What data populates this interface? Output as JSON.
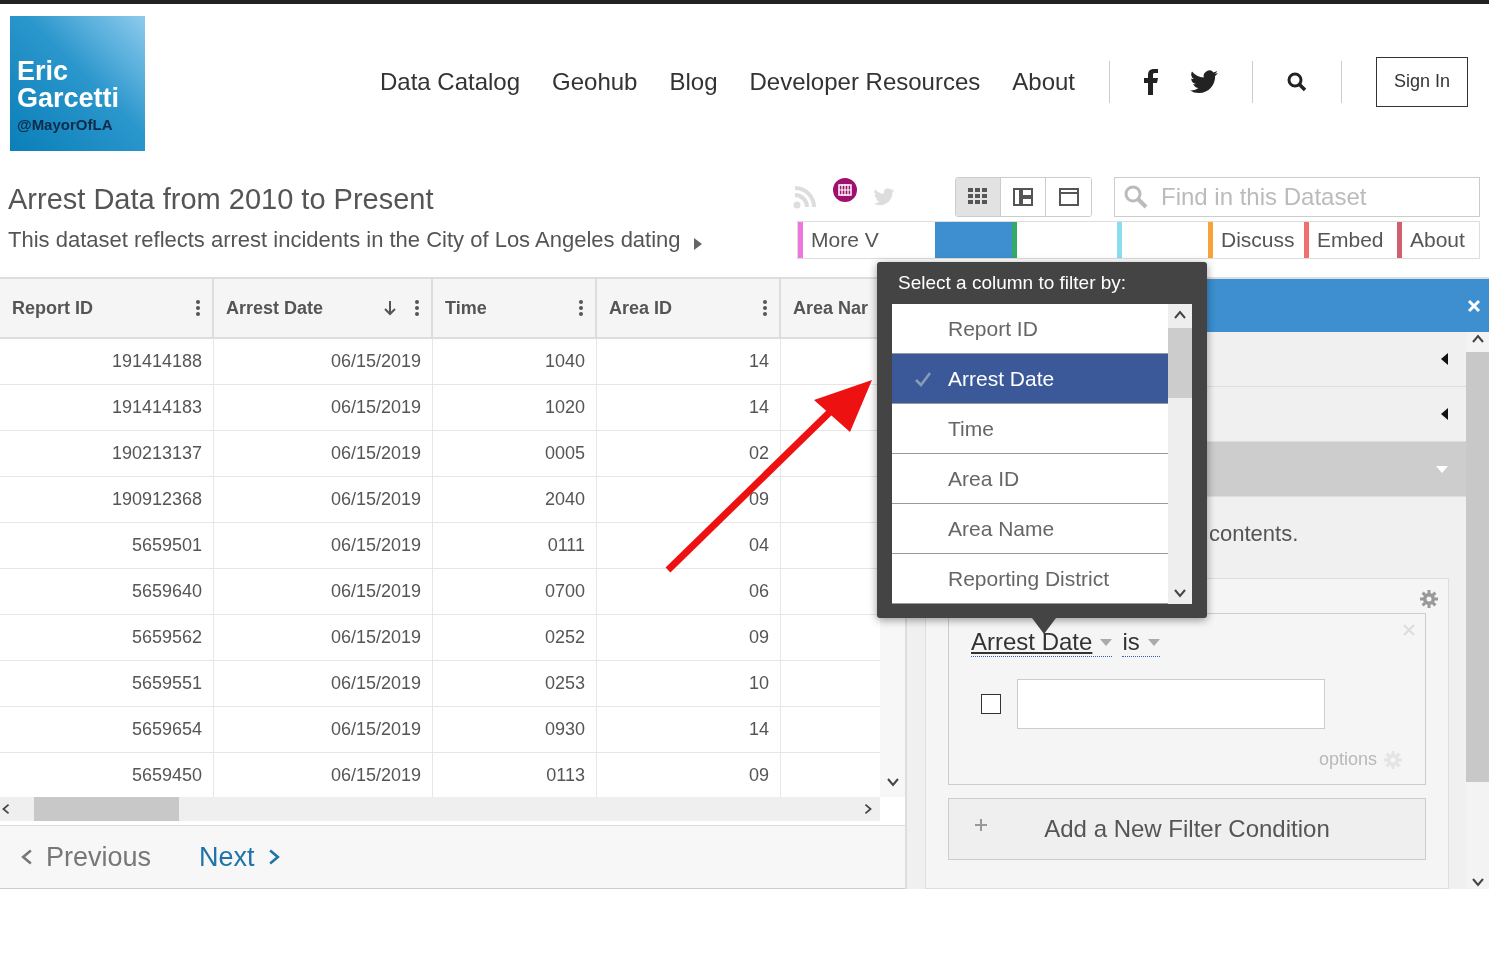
{
  "logo": {
    "line1": "Eric",
    "line2": "Garcetti",
    "handle": "@MayorOfLA"
  },
  "nav": {
    "links": [
      "Data Catalog",
      "Geohub",
      "Blog",
      "Developer Resources",
      "About"
    ],
    "sign_in": "Sign In"
  },
  "dataset": {
    "title": "Arrest Data from 2010 to Present",
    "description": "This dataset reflects arrest incidents in the City of Los Angeles dating"
  },
  "view_modes": [
    {
      "selected": true
    },
    {
      "selected": false
    },
    {
      "selected": false
    }
  ],
  "search": {
    "placeholder": "Find in this Dataset"
  },
  "tabs": [
    {
      "label": "More V",
      "selected": false,
      "color": "#ee77dd"
    },
    {
      "selected": true,
      "color": "#3d8fcf"
    },
    {
      "selected": false,
      "color": "#33aa66"
    },
    {
      "selected": false,
      "color": "#88ddee"
    },
    {
      "label": "Discuss",
      "selected": false,
      "color": "#f5a33a"
    },
    {
      "label": "Embed",
      "selected": false,
      "color": "#f07070"
    },
    {
      "label": "About",
      "selected": false,
      "color": "#d06070"
    }
  ],
  "table": {
    "columns": [
      {
        "label": "Report ID",
        "sorted": false
      },
      {
        "label": "Arrest Date",
        "sorted": true
      },
      {
        "label": "Time",
        "sorted": false
      },
      {
        "label": "Area ID",
        "sorted": false
      },
      {
        "label": "Area Nar",
        "sorted": false
      }
    ],
    "rows": [
      [
        "191414188",
        "06/15/2019",
        "1040",
        "14"
      ],
      [
        "191414183",
        "06/15/2019",
        "1020",
        "14"
      ],
      [
        "190213137",
        "06/15/2019",
        "0005",
        "02"
      ],
      [
        "190912368",
        "06/15/2019",
        "2040",
        "09"
      ],
      [
        "5659501",
        "06/15/2019",
        "0111",
        "04"
      ],
      [
        "5659640",
        "06/15/2019",
        "0700",
        "06"
      ],
      [
        "5659562",
        "06/15/2019",
        "0252",
        "09"
      ],
      [
        "5659551",
        "06/15/2019",
        "0253",
        "10"
      ],
      [
        "5659654",
        "06/15/2019",
        "0930",
        "14"
      ],
      [
        "5659450",
        "06/15/2019",
        "0113",
        "09"
      ]
    ]
  },
  "pager": {
    "previous": "Previous",
    "next": "Next"
  },
  "filter_panel": {
    "sections": [
      {
        "expanded": false
      },
      {
        "expanded": false
      },
      {
        "expanded": true
      }
    ],
    "note": "contents.",
    "condition": {
      "column": "Arrest Date",
      "operator": "is",
      "checked": false,
      "options": "options"
    },
    "add_button": "Add a New Filter Condition"
  },
  "column_popup": {
    "title": "Select a column to filter by:",
    "items": [
      {
        "label": "Report ID",
        "selected": false
      },
      {
        "label": "Arrest Date",
        "selected": true
      },
      {
        "label": "Time",
        "selected": false
      },
      {
        "label": "Area ID",
        "selected": false
      },
      {
        "label": "Area Name",
        "selected": false
      },
      {
        "label": "Reporting District",
        "selected": false
      }
    ]
  }
}
